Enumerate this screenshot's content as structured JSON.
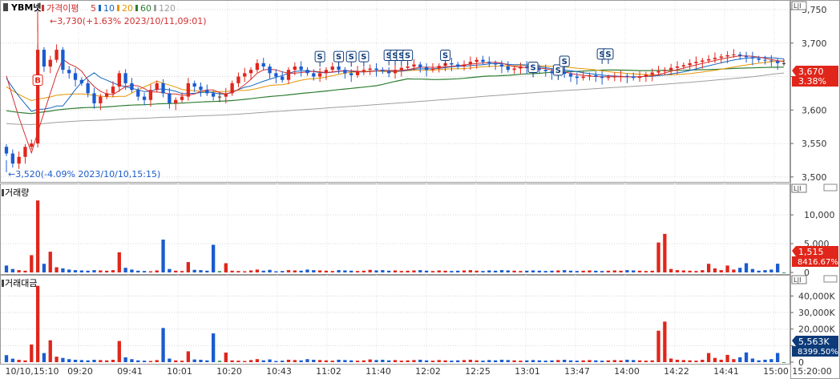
{
  "main_panel": {
    "stock_name": "YBM넷",
    "legend": [
      {
        "label": "가격이평",
        "color": "#d32f2f"
      },
      {
        "label": "5",
        "color": "#d32f2f"
      },
      {
        "label": "10",
        "color": "#1565c0"
      },
      {
        "label": "20",
        "color": "#e69500"
      },
      {
        "label": "60",
        "color": "#2e7d32"
      },
      {
        "label": "120",
        "color": "#9e9e9e"
      }
    ],
    "high_annotation": "←3,730(+1.63% 2023/10/11,09:01)",
    "low_annotation": "←3,520(-4.09% 2023/10/10,15:15)",
    "buy_marker": "B",
    "signal_marker": "S",
    "current_price_label": "3,670",
    "current_change_label": "3.38%",
    "axis_toggle": "L|I"
  },
  "volume_panel": {
    "title": "거래량",
    "current_label": "1,515",
    "ratio_label": "8416.67%",
    "axis_toggle": "L|I"
  },
  "amount_panel": {
    "title": "거래대금",
    "current_label": "5,563K",
    "ratio_label": "8399.50%",
    "axis_toggle": "L|I"
  },
  "colors": {
    "up": "#e0261b",
    "down": "#1a5bd0",
    "neutral": "#3e9c5a",
    "ma5": "#d32f2f",
    "ma10": "#1565c0",
    "ma20": "#e69500",
    "ma60": "#2e7d32",
    "ma120": "#9e9e9e",
    "badge_red": "#e0261b",
    "badge_navy": "#0d3b7a"
  },
  "chart_data": [
    {
      "type": "candlestick",
      "title": "YBM넷",
      "y_ticks": [
        "3,750",
        "3,700",
        "3,650",
        "3,600",
        "3,550",
        "3,500"
      ],
      "ylim": [
        3495,
        3762
      ],
      "x_tick_labels": [
        "10/10,15:10",
        "09:20",
        "09:41",
        "10:01",
        "10:20",
        "10:43",
        "11:02",
        "11:40",
        "12:02",
        "12:25",
        "13:01",
        "13:47",
        "14:00",
        "14:22",
        "14:41",
        "15:00",
        "15:20:00"
      ],
      "close": [
        3535,
        3520,
        3530,
        3545,
        3550,
        3690,
        3665,
        3675,
        3690,
        3660,
        3655,
        3645,
        3640,
        3625,
        3610,
        3620,
        3625,
        3635,
        3655,
        3640,
        3630,
        3620,
        3615,
        3630,
        3640,
        3625,
        3610,
        3615,
        3620,
        3640,
        3635,
        3630,
        3625,
        3620,
        3620,
        3625,
        3640,
        3650,
        3655,
        3660,
        3670,
        3665,
        3655,
        3650,
        3645,
        3660,
        3665,
        3660,
        3655,
        3650,
        3655,
        3660,
        3665,
        3660,
        3655,
        3652,
        3658,
        3660,
        3662,
        3660,
        3658,
        3655,
        3660,
        3663,
        3665,
        3668,
        3664,
        3660,
        3662,
        3666,
        3670,
        3668,
        3665,
        3668,
        3672,
        3675,
        3672,
        3670,
        3668,
        3665,
        3660,
        3662,
        3665,
        3664,
        3662,
        3660,
        3658,
        3655,
        3657,
        3654,
        3650,
        3648,
        3650,
        3652,
        3650,
        3648,
        3649,
        3650,
        3651,
        3650,
        3648,
        3650,
        3653,
        3656,
        3658,
        3660,
        3663,
        3665,
        3667,
        3670,
        3672,
        3674,
        3676,
        3678,
        3680,
        3682,
        3683,
        3681,
        3679,
        3677,
        3675,
        3674,
        3673,
        3670,
        3670
      ],
      "volume": [
        1200,
        600,
        400,
        300,
        3000,
        12500,
        1500,
        3600,
        900,
        700,
        500,
        400,
        350,
        300,
        400,
        350,
        300,
        400,
        3500,
        800,
        500,
        300,
        250,
        200,
        350,
        5700,
        600,
        300,
        250,
        1800,
        450,
        400,
        300,
        4800,
        250,
        1600,
        300,
        250,
        200,
        350,
        500,
        300,
        450,
        200,
        250,
        400,
        350,
        300,
        500,
        400,
        350,
        300,
        250,
        400,
        350,
        300,
        250,
        300,
        450,
        350,
        400,
        300,
        350,
        250,
        300,
        350,
        400,
        300,
        250,
        350,
        300,
        250,
        300,
        350,
        400,
        300,
        250,
        350,
        300,
        400,
        350,
        300,
        250,
        300,
        350,
        300,
        250,
        300,
        350,
        400,
        300,
        250,
        300,
        350,
        300,
        250,
        300,
        350,
        300,
        400,
        350,
        300,
        250,
        300,
        5200,
        6700,
        600,
        400,
        350,
        300,
        250,
        400,
        1500,
        700,
        400,
        1200,
        500,
        800,
        1600,
        600,
        300,
        400,
        500,
        1515
      ],
      "volume_y_ticks": [
        "10,000",
        "5,000",
        "0"
      ],
      "amount_y_ticks": [
        "40,000K",
        "30,000K",
        "20,000K",
        "10,000K",
        "0"
      ],
      "markers": [
        {
          "kind": "B",
          "bar": 5,
          "price": 3650
        },
        {
          "kind": "S",
          "bar": 50,
          "price": 3672
        },
        {
          "kind": "S",
          "bar": 53,
          "price": 3672
        },
        {
          "kind": "S",
          "bar": 55,
          "price": 3672
        },
        {
          "kind": "S",
          "bar": 57,
          "price": 3672
        },
        {
          "kind": "S",
          "bar": 61,
          "price": 3674
        },
        {
          "kind": "S",
          "bar": 62,
          "price": 3674
        },
        {
          "kind": "S",
          "bar": 63,
          "price": 3674
        },
        {
          "kind": "S",
          "bar": 64,
          "price": 3674
        },
        {
          "kind": "S",
          "bar": 70,
          "price": 3674
        },
        {
          "kind": "S",
          "bar": 84,
          "price": 3656
        },
        {
          "kind": "S",
          "bar": 88,
          "price": 3652
        },
        {
          "kind": "S",
          "bar": 89,
          "price": 3665
        },
        {
          "kind": "S",
          "bar": 95,
          "price": 3676
        },
        {
          "kind": "S",
          "bar": 96,
          "price": 3676
        }
      ]
    }
  ]
}
